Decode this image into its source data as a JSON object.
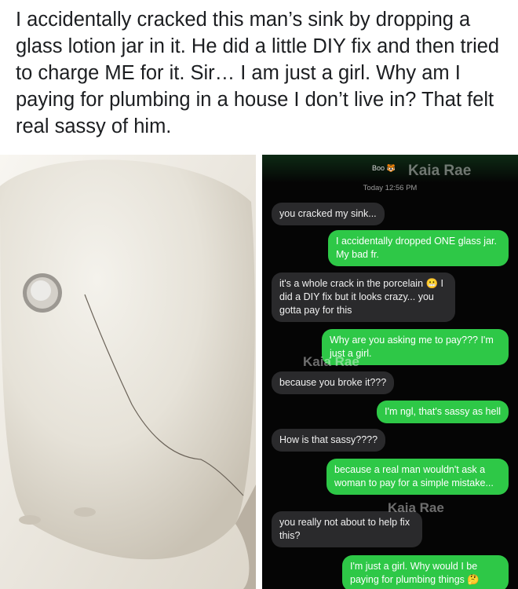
{
  "post": {
    "caption": "I accidentally cracked this man’s sink by dropping a glass lotion jar in it. He did a little DIY fix and then tried to charge ME for it. Sir… I am just a girl. Why am I paying for plumbing in a house I don’t live in? That felt real sassy of him."
  },
  "chat": {
    "contact_name": "Boo",
    "contact_emoji": "🐯",
    "timestamp": "Today 12:56 PM",
    "watermark": "Kaia Rae",
    "colors": {
      "incoming": "#2a2a2c",
      "outgoing": "#2ec847",
      "background": "#050505"
    },
    "messages": [
      {
        "from": "them",
        "text": "you cracked my sink..."
      },
      {
        "from": "me",
        "text": "I accidentally dropped ONE glass jar. My bad fr."
      },
      {
        "from": "them",
        "text": "it's a whole crack in the porcelain 😬 I did a DIY fix but it looks crazy... you gotta pay for this"
      },
      {
        "from": "me",
        "text": "Why are you asking me to pay??? I'm just a girl."
      },
      {
        "from": "them",
        "text": "because you broke it???"
      },
      {
        "from": "me",
        "text": "I'm ngl, that's sassy as hell"
      },
      {
        "from": "them",
        "text": "How is that sassy????"
      },
      {
        "from": "me",
        "text": "because a real man wouldn't ask a woman to pay for a simple mistake..."
      },
      {
        "from": "them",
        "text": "you really not about to help fix this?"
      },
      {
        "from": "me",
        "text": "I'm just a girl. Why would I be paying for plumbing things 🤔"
      }
    ]
  }
}
